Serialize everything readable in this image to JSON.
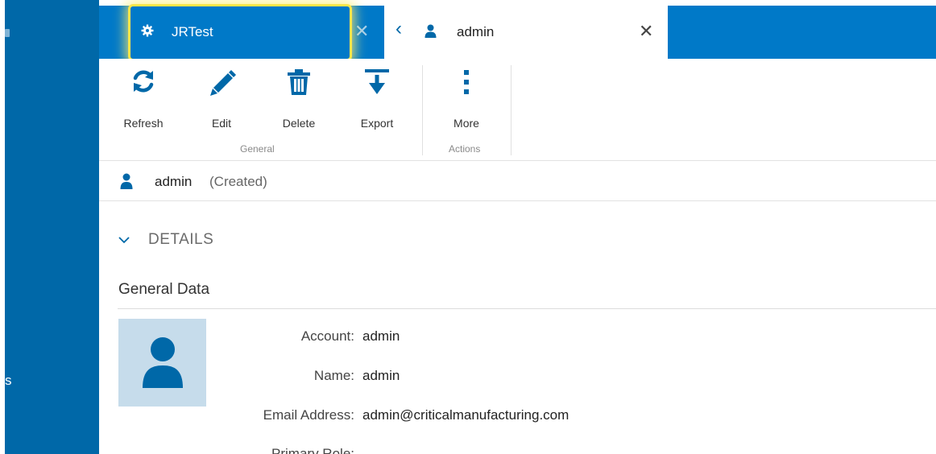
{
  "tabs": {
    "active": {
      "label": "JRTest",
      "icon": "gear-icon"
    },
    "secondary": {
      "label": "admin",
      "icon": "user-icon"
    }
  },
  "toolbar": {
    "refresh_label": "Refresh",
    "edit_label": "Edit",
    "delete_label": "Delete",
    "export_label": "Export",
    "more_label": "More",
    "group_general": "General",
    "group_actions": "Actions"
  },
  "sidebar": {
    "fragment_text": "s"
  },
  "entity": {
    "name": "admin",
    "state": "(Created)"
  },
  "details": {
    "toggle_label": "DETAILS",
    "section_title": "General Data",
    "fields": [
      {
        "label": "Account:",
        "value": "admin"
      },
      {
        "label": "Name:",
        "value": "admin"
      },
      {
        "label": "Email Address:",
        "value": "admin@criticalmanufacturing.com"
      },
      {
        "label": "Primary Role:",
        "value": ""
      }
    ]
  },
  "colors": {
    "sidebar": "#0068a8",
    "tab_bar": "#0079c8",
    "highlight": "#ffe64b",
    "icon": "#0068a8"
  }
}
